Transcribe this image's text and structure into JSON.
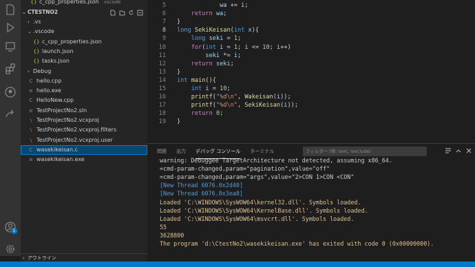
{
  "activity_bar": {
    "account_badge": "1"
  },
  "sidebar": {
    "top_partial": {
      "label": "c_cpp_properties.json",
      "hint": ".vscode"
    },
    "section_title": "CTESTNO2",
    "items": [
      {
        "label": ".vs",
        "kind": "folder",
        "expanded": false,
        "depth": 0,
        "icon": "chevron-right"
      },
      {
        "label": ".vscode",
        "kind": "folder",
        "expanded": true,
        "depth": 0,
        "icon": "chevron-down"
      },
      {
        "label": "c_cpp_properties.json",
        "kind": "json",
        "depth": 1,
        "icon": "{}"
      },
      {
        "label": "launch.json",
        "kind": "json",
        "depth": 1,
        "icon": "{}"
      },
      {
        "label": "tasks.json",
        "kind": "json",
        "depth": 1,
        "icon": "{}"
      },
      {
        "label": "Debug",
        "kind": "folder",
        "expanded": false,
        "depth": 0,
        "icon": "chevron-right"
      },
      {
        "label": "hello.cpp",
        "kind": "cpp",
        "depth": 0,
        "icon": "C"
      },
      {
        "label": "hello.exe",
        "kind": "exe",
        "depth": 0,
        "icon": "≡"
      },
      {
        "label": "HelloNew.cpp",
        "kind": "cpp",
        "depth": 0,
        "icon": "C"
      },
      {
        "label": "TestProjectNo2.sln",
        "kind": "sln",
        "depth": 0,
        "icon": "≡"
      },
      {
        "label": "TestProjectNo2.vcxproj",
        "kind": "xml",
        "depth": 0,
        "icon": "\\"
      },
      {
        "label": "TestProjectNo2.vcxproj.filters",
        "kind": "xml",
        "depth": 0,
        "icon": "\\"
      },
      {
        "label": "TestProjectNo2.vcxproj.user",
        "kind": "xml",
        "depth": 0,
        "icon": "\\"
      },
      {
        "label": "wasekikeisan.c",
        "kind": "c",
        "depth": 0,
        "icon": "C",
        "selected": true
      },
      {
        "label": "wasekikeisan.exe",
        "kind": "exe",
        "depth": 0,
        "icon": "≡"
      }
    ],
    "outline_label": "アウトライン"
  },
  "editor": {
    "lines": [
      {
        "n": "5",
        "code": [
          [
            "            ",
            ""
          ],
          [
            "wa",
            "var"
          ],
          [
            " += ",
            ""
          ],
          [
            "i",
            "var"
          ],
          [
            ";",
            ""
          ]
        ]
      },
      {
        "n": "6",
        "code": [
          [
            "    ",
            ""
          ],
          [
            "return",
            "ctl"
          ],
          [
            " ",
            ""
          ],
          [
            "wa",
            "var"
          ],
          [
            ";",
            ""
          ]
        ]
      },
      {
        "n": "7",
        "code": [
          [
            "}",
            ""
          ]
        ]
      },
      {
        "n": "8",
        "active": true,
        "code": [
          [
            "long",
            "kw"
          ],
          [
            " ",
            ""
          ],
          [
            "SekiKeisan",
            "fn"
          ],
          [
            "(",
            ""
          ],
          [
            "int",
            "kw"
          ],
          [
            " ",
            ""
          ],
          [
            "x",
            "var"
          ],
          [
            "){",
            ""
          ]
        ]
      },
      {
        "n": "9",
        "code": [
          [
            "    ",
            ""
          ],
          [
            "long",
            "kw"
          ],
          [
            " ",
            ""
          ],
          [
            "seki",
            "var"
          ],
          [
            " = ",
            ""
          ],
          [
            "1",
            "num"
          ],
          [
            ";",
            ""
          ]
        ]
      },
      {
        "n": "10",
        "code": [
          [
            "    ",
            ""
          ],
          [
            "for",
            "ctl"
          ],
          [
            "(",
            ""
          ],
          [
            "int",
            "kw"
          ],
          [
            " ",
            ""
          ],
          [
            "i",
            "var"
          ],
          [
            " = ",
            ""
          ],
          [
            "1",
            "num"
          ],
          [
            "; ",
            ""
          ],
          [
            "i",
            "var"
          ],
          [
            " <= ",
            ""
          ],
          [
            "10",
            "num"
          ],
          [
            "; ",
            ""
          ],
          [
            "i",
            "var"
          ],
          [
            "++)",
            ""
          ]
        ]
      },
      {
        "n": "11",
        "code": [
          [
            "        ",
            ""
          ],
          [
            "seki",
            "var"
          ],
          [
            " *= ",
            ""
          ],
          [
            "i",
            "var"
          ],
          [
            ";",
            ""
          ]
        ]
      },
      {
        "n": "12",
        "code": [
          [
            "    ",
            ""
          ],
          [
            "return",
            "ctl"
          ],
          [
            " ",
            ""
          ],
          [
            "seki",
            "var"
          ],
          [
            ";",
            ""
          ]
        ]
      },
      {
        "n": "13",
        "code": [
          [
            "}",
            ""
          ]
        ]
      },
      {
        "n": "14",
        "code": [
          [
            "int",
            "kw"
          ],
          [
            " ",
            ""
          ],
          [
            "main",
            "fn"
          ],
          [
            "(){",
            ""
          ]
        ]
      },
      {
        "n": "15",
        "code": [
          [
            "    ",
            ""
          ],
          [
            "int",
            "kw"
          ],
          [
            " ",
            ""
          ],
          [
            "i",
            "var"
          ],
          [
            " = ",
            ""
          ],
          [
            "10",
            "num"
          ],
          [
            ";",
            ""
          ]
        ]
      },
      {
        "n": "16",
        "code": [
          [
            "    ",
            ""
          ],
          [
            "printf",
            "fn"
          ],
          [
            "(",
            ""
          ],
          [
            "\"%d\\n\"",
            "str"
          ],
          [
            ", ",
            ""
          ],
          [
            "Wakeisan",
            "fn"
          ],
          [
            "(",
            ""
          ],
          [
            "i",
            "var"
          ],
          [
            "));",
            ""
          ]
        ]
      },
      {
        "n": "17",
        "code": [
          [
            "    ",
            ""
          ],
          [
            "printf",
            "fn"
          ],
          [
            "(",
            ""
          ],
          [
            "\"%d\\n\"",
            "str"
          ],
          [
            ", ",
            ""
          ],
          [
            "SekiKeisan",
            "fn"
          ],
          [
            "(",
            ""
          ],
          [
            "i",
            "var"
          ],
          [
            "));",
            ""
          ]
        ]
      },
      {
        "n": "18",
        "code": [
          [
            "    ",
            ""
          ],
          [
            "return",
            "ctl"
          ],
          [
            " ",
            ""
          ],
          [
            "0",
            "num"
          ],
          [
            ";",
            ""
          ]
        ]
      },
      {
        "n": "19",
        "code": [
          [
            "}",
            ""
          ]
        ]
      }
    ]
  },
  "panel": {
    "tabs": [
      "問題",
      "出力",
      "デバッグ コンソール",
      "ターミナル"
    ],
    "active_tab": 2,
    "filter_placeholder": "フィルター (例: text, !exclude)",
    "output": [
      {
        "text": "warning: Debuggee TargetArchitecture not detected, assuming x86_64.",
        "color": "w"
      },
      {
        "text": "=cmd-param-changed,param=\"pagination\",value=\"off\"",
        "color": "w"
      },
      {
        "text": "=cmd-param-changed,param=\"args\",value=\"2>CON 1>CON <CON\"",
        "color": "w"
      },
      {
        "text": "[New Thread 6076.0x2d40]",
        "color": "b"
      },
      {
        "text": "[New Thread 6076.0x3ea8]",
        "color": "b"
      },
      {
        "text": "Loaded 'C:\\WINDOWS\\SysWOW64\\kernel32.dll'. Symbols loaded.",
        "color": "y"
      },
      {
        "text": "Loaded 'C:\\WINDOWS\\SysWOW64\\KernelBase.dll'. Symbols loaded.",
        "color": "y"
      },
      {
        "text": "Loaded 'C:\\WINDOWS\\SysWOW64\\msvcrt.dll'. Symbols loaded.",
        "color": "y"
      },
      {
        "text": "55",
        "color": "y"
      },
      {
        "text": "3628800",
        "color": "y"
      },
      {
        "text": "The program 'd:\\CtestNo2\\wasekikeisan.exe' has exited with code 0 (0x00000000).",
        "color": "y"
      }
    ]
  },
  "colors": {
    "accent": "#007acc",
    "selection": "#094771",
    "json_icon": "#cbcb41",
    "c_icon": "#519aba",
    "xml_icon": "#e37933"
  }
}
